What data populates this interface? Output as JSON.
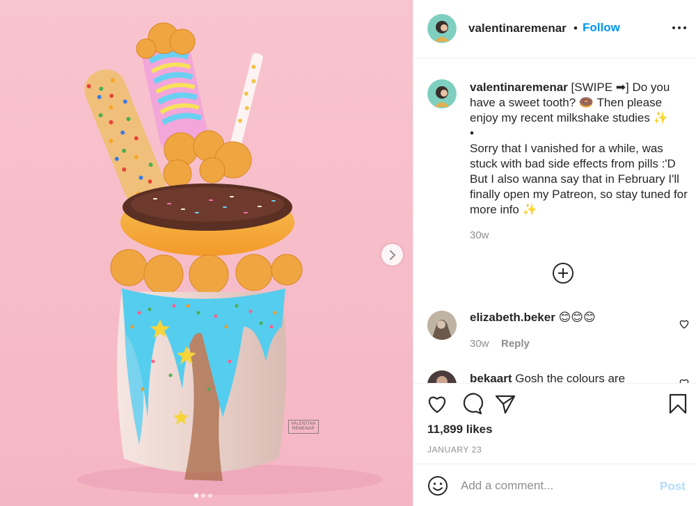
{
  "post": {
    "username": "valentinaremenar",
    "follow_label": "Follow",
    "separator": "•",
    "more_icon": "more-dots-icon"
  },
  "artwork": {
    "signature": "VALENTINA REMENAR",
    "background_color": "#f7bfcb",
    "carousel": {
      "slides": 3,
      "active": 1
    }
  },
  "caption": {
    "username": "valentinaremenar",
    "lines": [
      "[SWIPE ➡] Do you have a sweet tooth? 🍩 Then please enjoy my recent milkshake studies ✨",
      "•",
      "Sorry that I vanished for a while, was stuck with bad side effects from pills :'D But I also wanna say that in February I'll finally open my Patreon, so stay tuned for more info ✨"
    ],
    "time": "30w"
  },
  "comments": [
    {
      "username": "elizabeth.beker",
      "text": "😊😊😊",
      "time": "30w",
      "reply_label": "Reply"
    },
    {
      "username": "bekaart",
      "text": "Gosh the colours are"
    }
  ],
  "actions": {
    "likes": "11,899 likes",
    "date": "JANUARY 23"
  },
  "add_comment": {
    "placeholder": "Add a comment...",
    "post_label": "Post"
  },
  "colors": {
    "link": "#0095f6",
    "post_disabled": "#b3dbff",
    "muted_text": "#8e8e8e"
  }
}
